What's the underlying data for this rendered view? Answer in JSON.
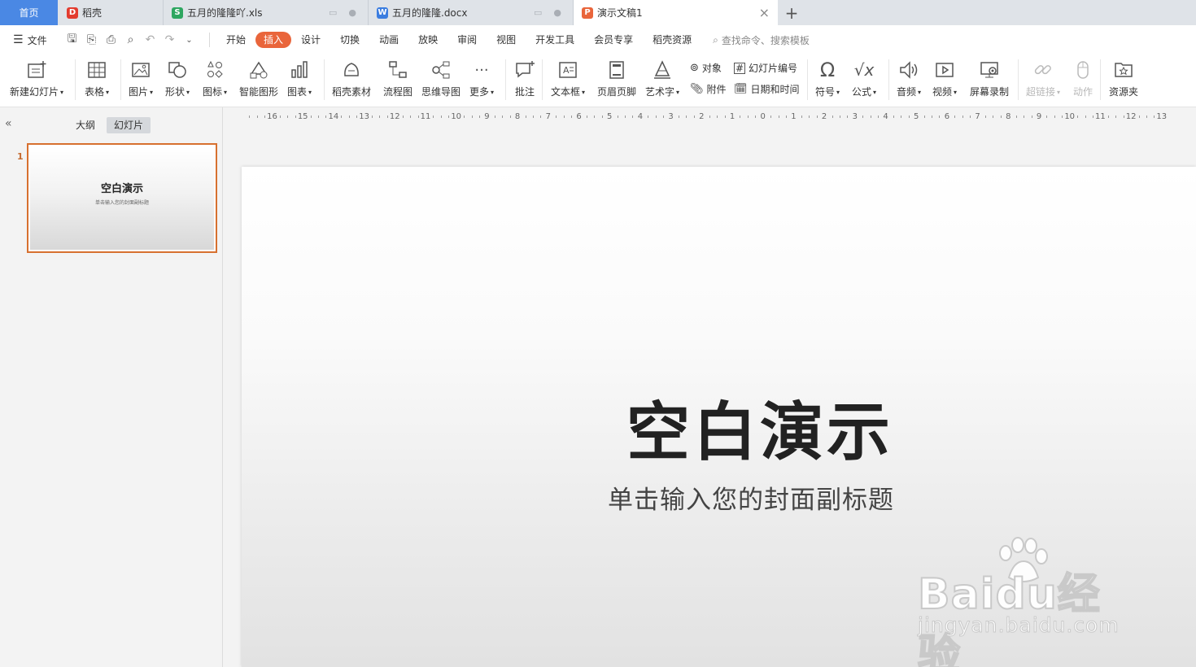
{
  "tabs": {
    "home": "首页",
    "docer": "稻壳",
    "xls": "五月的隆隆吖.xls",
    "docx": "五月的隆隆.docx",
    "ppt": "演示文稿1",
    "logo_docer": "D",
    "logo_xls": "S",
    "logo_docx": "W",
    "logo_ppt": "P"
  },
  "menu": {
    "file": "文件",
    "items": [
      "开始",
      "插入",
      "设计",
      "切换",
      "动画",
      "放映",
      "审阅",
      "视图",
      "开发工具",
      "会员专享",
      "稻壳资源"
    ],
    "active": "插入",
    "search": "查找命令、搜索模板"
  },
  "ribbon": {
    "new_slide": "新建幻灯片",
    "table": "表格",
    "picture": "图片",
    "shape": "形状",
    "icon": "图标",
    "smartart": "智能图形",
    "chart": "图表",
    "docer_material": "稻壳素材",
    "flowchart": "流程图",
    "mindmap": "思维导图",
    "more": "更多",
    "comment": "批注",
    "textbox": "文本框",
    "header_footer": "页眉页脚",
    "wordart": "艺术字",
    "object": "对象",
    "attachment": "附件",
    "slide_number": "幻灯片编号",
    "datetime": "日期和时间",
    "symbol": "符号",
    "formula": "公式",
    "audio": "音频",
    "video": "视频",
    "screen_record": "屏幕录制",
    "hyperlink": "超链接",
    "action": "动作",
    "resource": "资源夹"
  },
  "left_panel": {
    "outline": "大纲",
    "slides": "幻灯片",
    "slide_number": "1",
    "thumb_title": "空白演示",
    "thumb_subtitle": "单击输入您的封面副标题"
  },
  "ruler": [
    "16",
    "15",
    "14",
    "13",
    "12",
    "11",
    "10",
    "9",
    "8",
    "7",
    "6",
    "5",
    "4",
    "3",
    "2",
    "1",
    "0",
    "1",
    "2",
    "3",
    "4",
    "5",
    "6",
    "7",
    "8",
    "9",
    "10",
    "11",
    "12",
    "13"
  ],
  "slide": {
    "title": "空白演示",
    "subtitle": "单击输入您的封面副标题"
  },
  "watermark": {
    "brand": "Baidu经验",
    "url": "jingyan.baidu.com"
  },
  "colors": {
    "accent": "#e9653b",
    "home_tab": "#4a88e4",
    "thumb_border": "#d7702f"
  }
}
